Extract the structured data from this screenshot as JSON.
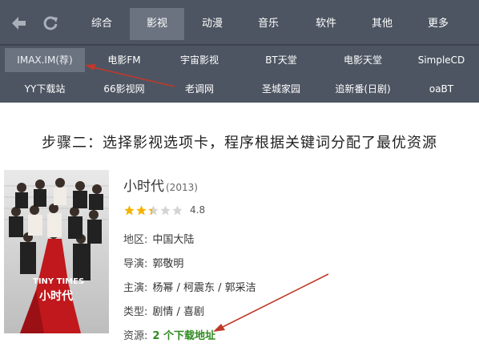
{
  "nav": {
    "back_icon": "back-arrow-icon",
    "refresh_icon": "refresh-icon",
    "tabs": [
      {
        "label": "综合",
        "active": false
      },
      {
        "label": "影视",
        "active": true
      },
      {
        "label": "动漫",
        "active": false
      },
      {
        "label": "音乐",
        "active": false
      },
      {
        "label": "软件",
        "active": false
      },
      {
        "label": "其他",
        "active": false
      },
      {
        "label": "更多",
        "active": false
      }
    ],
    "sites_row1": [
      "IMAX.IM(荐)",
      "电影FM",
      "宇宙影视",
      "BT天堂",
      "电影天堂",
      "SimpleCD"
    ],
    "sites_row2": [
      "YY下载站",
      "66影视网",
      "老调网",
      "圣城家园",
      "追新番(日剧)",
      "oaBT"
    ]
  },
  "step_text": "步骤二：选择影视选项卡，程序根据关键词分配了最优资源",
  "movie": {
    "title": "小时代",
    "year": "(2013)",
    "rating": 4.8,
    "rating_text": "4.8",
    "region_label": "地区:",
    "region": "中国大陆",
    "director_label": "导演:",
    "director": "郭敬明",
    "cast_label": "主演:",
    "cast": "杨幂 / 柯震东 / 郭采洁",
    "genre_label": "类型:",
    "genre": "剧情 / 喜剧",
    "resource_label": "资源:",
    "resource": "2 个下载地址",
    "poster_text_en": "TINY TIMES",
    "poster_text_cn": "小时代"
  },
  "colors": {
    "nav_bg": "#4d5562",
    "active_tab": "#6b7380",
    "annotation_arrow": "#c0392b",
    "resource_link": "#2e8b1e"
  }
}
